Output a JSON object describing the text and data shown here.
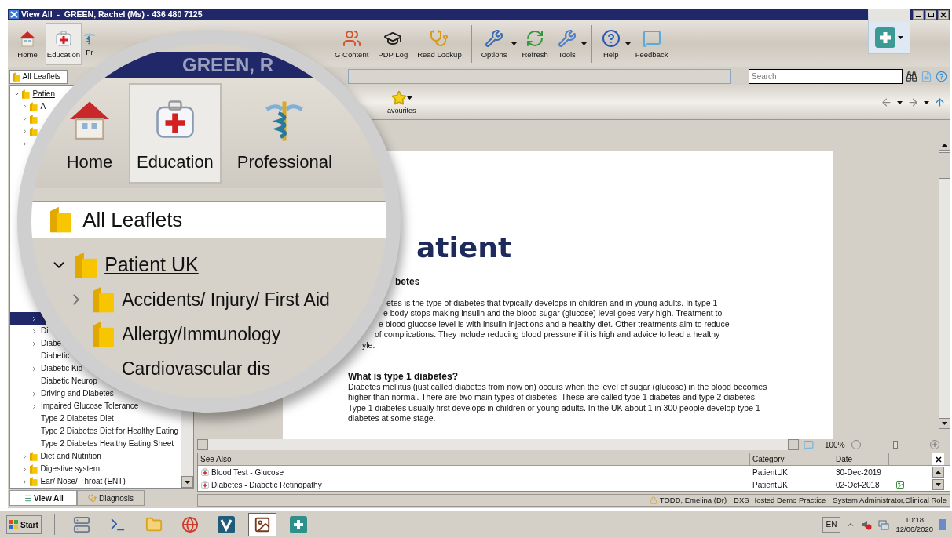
{
  "window": {
    "title": "View All  -  GREEN, Rachel (Ms) - 436 480 7125"
  },
  "toolbar_left": [
    {
      "label": "Home",
      "kind": "home",
      "selected": false
    },
    {
      "label": "Education",
      "kind": "education",
      "selected": true
    },
    {
      "label": "Pr",
      "kind": "professional",
      "selected": false
    }
  ],
  "toolbar_right": [
    {
      "label": "G Content",
      "kind": "people",
      "dropdown": false,
      "separator_after": false
    },
    {
      "label": "PDP Log",
      "kind": "graduate",
      "dropdown": false,
      "separator_after": false
    },
    {
      "label": "Read Lookup",
      "kind": "stethoscope",
      "dropdown": false,
      "separator_after": true
    },
    {
      "label": "Options",
      "kind": "options",
      "dropdown": true,
      "separator_after": false
    },
    {
      "label": "Refresh",
      "kind": "refresh",
      "dropdown": false,
      "separator_after": false
    },
    {
      "label": "Tools",
      "kind": "wrench",
      "dropdown": true,
      "separator_after": true
    },
    {
      "label": "Help",
      "kind": "help",
      "dropdown": true,
      "separator_after": false
    },
    {
      "label": "Feedback",
      "kind": "feedback",
      "dropdown": false,
      "separator_after": false
    }
  ],
  "filter": {
    "value": "All Leaflets"
  },
  "search": {
    "placeholder": "Search"
  },
  "favourites": {
    "label": "avourites"
  },
  "tree_top": [
    {
      "label": "Patien",
      "expanded": true,
      "children": [
        {
          "label": "A",
          "expandable": true,
          "folder": true
        },
        {
          "expandable": true,
          "folder": true
        },
        {
          "expandable": true,
          "folder": true
        },
        {
          "expandable": true,
          "folder": false
        }
      ]
    }
  ],
  "tree_lower": [
    {
      "expanded": true,
      "children": [
        {
          "expandable": true,
          "selected": true
        },
        {
          "label": "Di",
          "expandable": true,
          "selected": false
        },
        {
          "label": "Diabe",
          "expandable": true,
          "selected": false
        },
        {
          "label": "Diabetic",
          "expandable": false,
          "selected": false
        },
        {
          "label": "Diabetic Kid",
          "expandable": true,
          "selected": false
        },
        {
          "label": "Diabetic Neurop",
          "expandable": false,
          "selected": false
        },
        {
          "label": "Driving and Diabetes",
          "expandable": true,
          "selected": false
        },
        {
          "label": "Impaired Glucose Tolerance",
          "expandable": true,
          "selected": false
        },
        {
          "label": "Type 2 Diabetes Diet",
          "expandable": false,
          "selected": false
        },
        {
          "label": "Type 2 Diabetes Diet for Healthy Eating",
          "expandable": false,
          "selected": false
        },
        {
          "label": "Type 2 Diabetes Healthy Eating Sheet",
          "expandable": false,
          "selected": false
        }
      ]
    },
    {
      "label": "Diet and Nutrition",
      "expandable": true,
      "selected": false
    },
    {
      "label": "Digestive system",
      "expandable": true,
      "selected": false
    },
    {
      "label": "Ear/ Nose/ Throat (ENT)",
      "expandable": true,
      "selected": false
    }
  ],
  "bottom_tabs": [
    {
      "label": "View All",
      "kind": "list",
      "selected": true
    },
    {
      "label": "Diagnosis",
      "kind": "stethoscope",
      "selected": false
    }
  ],
  "document": {
    "logo": "atient",
    "heading": "betes",
    "intro_lines": [
      "etes is the type of diabetes that typically develops in children and in young adults. In type 1",
      "e body stops making insulin and the blood sugar (glucose) level goes very high. Treatment to",
      "e blood glucose level is with insulin injections and a healthy diet. Other treatments aim to reduce",
      "of complications. They include reducing blood pressure if it is high and advice to lead a healthy",
      "yle."
    ],
    "sections": [
      {
        "heading": "What is type 1 diabetes?",
        "paragraphs": [
          "Diabetes mellitus (just called diabetes from now on) occurs when the level of sugar (glucose) in the blood becomes higher than normal. There are two main types of diabetes. These are called type 1 diabetes and type 2 diabetes.",
          "Type 1 diabetes usually first develops in children or young adults. In the UK about 1 in 300 people develop type 1 diabetes at some stage."
        ]
      }
    ]
  },
  "zoom": {
    "reading": "100%",
    "level": 0.5
  },
  "see_also": {
    "columns": [
      "See Also",
      "Category",
      "Date"
    ],
    "rows": [
      {
        "title": "Blood Test - Glucose",
        "category": "PatientUK",
        "date": "30-Dec-2019",
        "has_image": false
      },
      {
        "title": "Diabetes - Diabetic Retinopathy",
        "category": "PatientUK",
        "date": "02-Oct-2018",
        "has_image": true
      }
    ]
  },
  "status_bar": {
    "user": "TODD, Emelina (Dr)",
    "practice": "DXS Hosted Demo Practice",
    "role": "System Administrator,Clinical Role"
  },
  "lens": {
    "banner": "GREEN, R",
    "toolbar": [
      {
        "label": "Home",
        "kind": "home",
        "selected": false
      },
      {
        "label": "Education",
        "kind": "education",
        "selected": true
      },
      {
        "label": "Professional",
        "kind": "professional",
        "selected": false
      }
    ],
    "filter": "All Leaflets",
    "tree": [
      {
        "label": "Patient UK",
        "expanded": true,
        "children": [
          {
            "label": "Accidents/ Injury/ First Aid",
            "expandable": true,
            "folder": true
          },
          {
            "label": "Allergy/Immunology",
            "expandable": false,
            "folder": true
          },
          {
            "label": "Cardiovascular dis",
            "expandable": false,
            "folder": false
          }
        ]
      }
    ]
  },
  "taskbar": {
    "start": "Start",
    "apps": [
      {
        "kind": "server",
        "active": false
      },
      {
        "kind": "terminal",
        "active": false
      },
      {
        "kind": "folder",
        "active": false
      },
      {
        "kind": "browser",
        "active": false
      },
      {
        "kind": "v",
        "active": false
      },
      {
        "kind": "picture",
        "active": true
      },
      {
        "kind": "plus",
        "active": false
      }
    ],
    "language": "EN",
    "time": "10:18",
    "date": "12/06/2020"
  }
}
